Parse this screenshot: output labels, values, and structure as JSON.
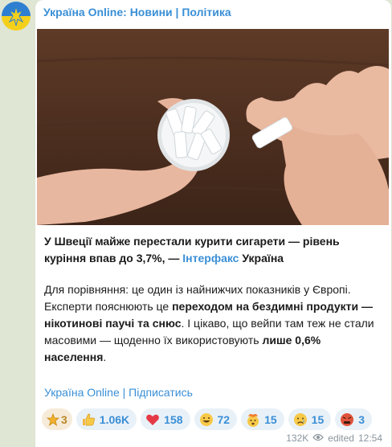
{
  "channel": {
    "name": "Україна Online: Новини | Політика"
  },
  "post": {
    "headline_part1": "У Швеції майже перестали курити сигарети — рівень куріння впав до 3,7%, — ",
    "headline_link": "Інтерфакс",
    "headline_part2": " Україна",
    "body_part1": "Для порівняння: це один із найнижчих показників у Європі. Експерти пояснюють це ",
    "body_bold1": "переходом на бездимні продукти — нікотинові паучі та снюс",
    "body_part2": ". І цікаво, що вейпи там теж не стали масовими — щоденно їх використовують ",
    "body_bold2": "лише 0,6% населення",
    "body_part3": ".",
    "footer_link1": "Україна Online",
    "footer_separator": " | ",
    "footer_link2": "Підписатись"
  },
  "reactions": [
    {
      "icon": "star-icon",
      "count": "3"
    },
    {
      "icon": "thumbs-up-icon",
      "count": "1.06K"
    },
    {
      "icon": "heart-icon",
      "count": "158"
    },
    {
      "icon": "grinning-face-icon",
      "count": "72"
    },
    {
      "icon": "exploding-head-icon",
      "count": "15"
    },
    {
      "icon": "crying-face-icon",
      "count": "15"
    },
    {
      "icon": "angry-face-icon",
      "count": "3"
    }
  ],
  "meta": {
    "views": "132K",
    "edited_label": "edited",
    "time": "12:54"
  },
  "colors": {
    "accent": "#3a8fd6",
    "background": "#dfe6d4",
    "star_bg": "#f6ebd9"
  }
}
